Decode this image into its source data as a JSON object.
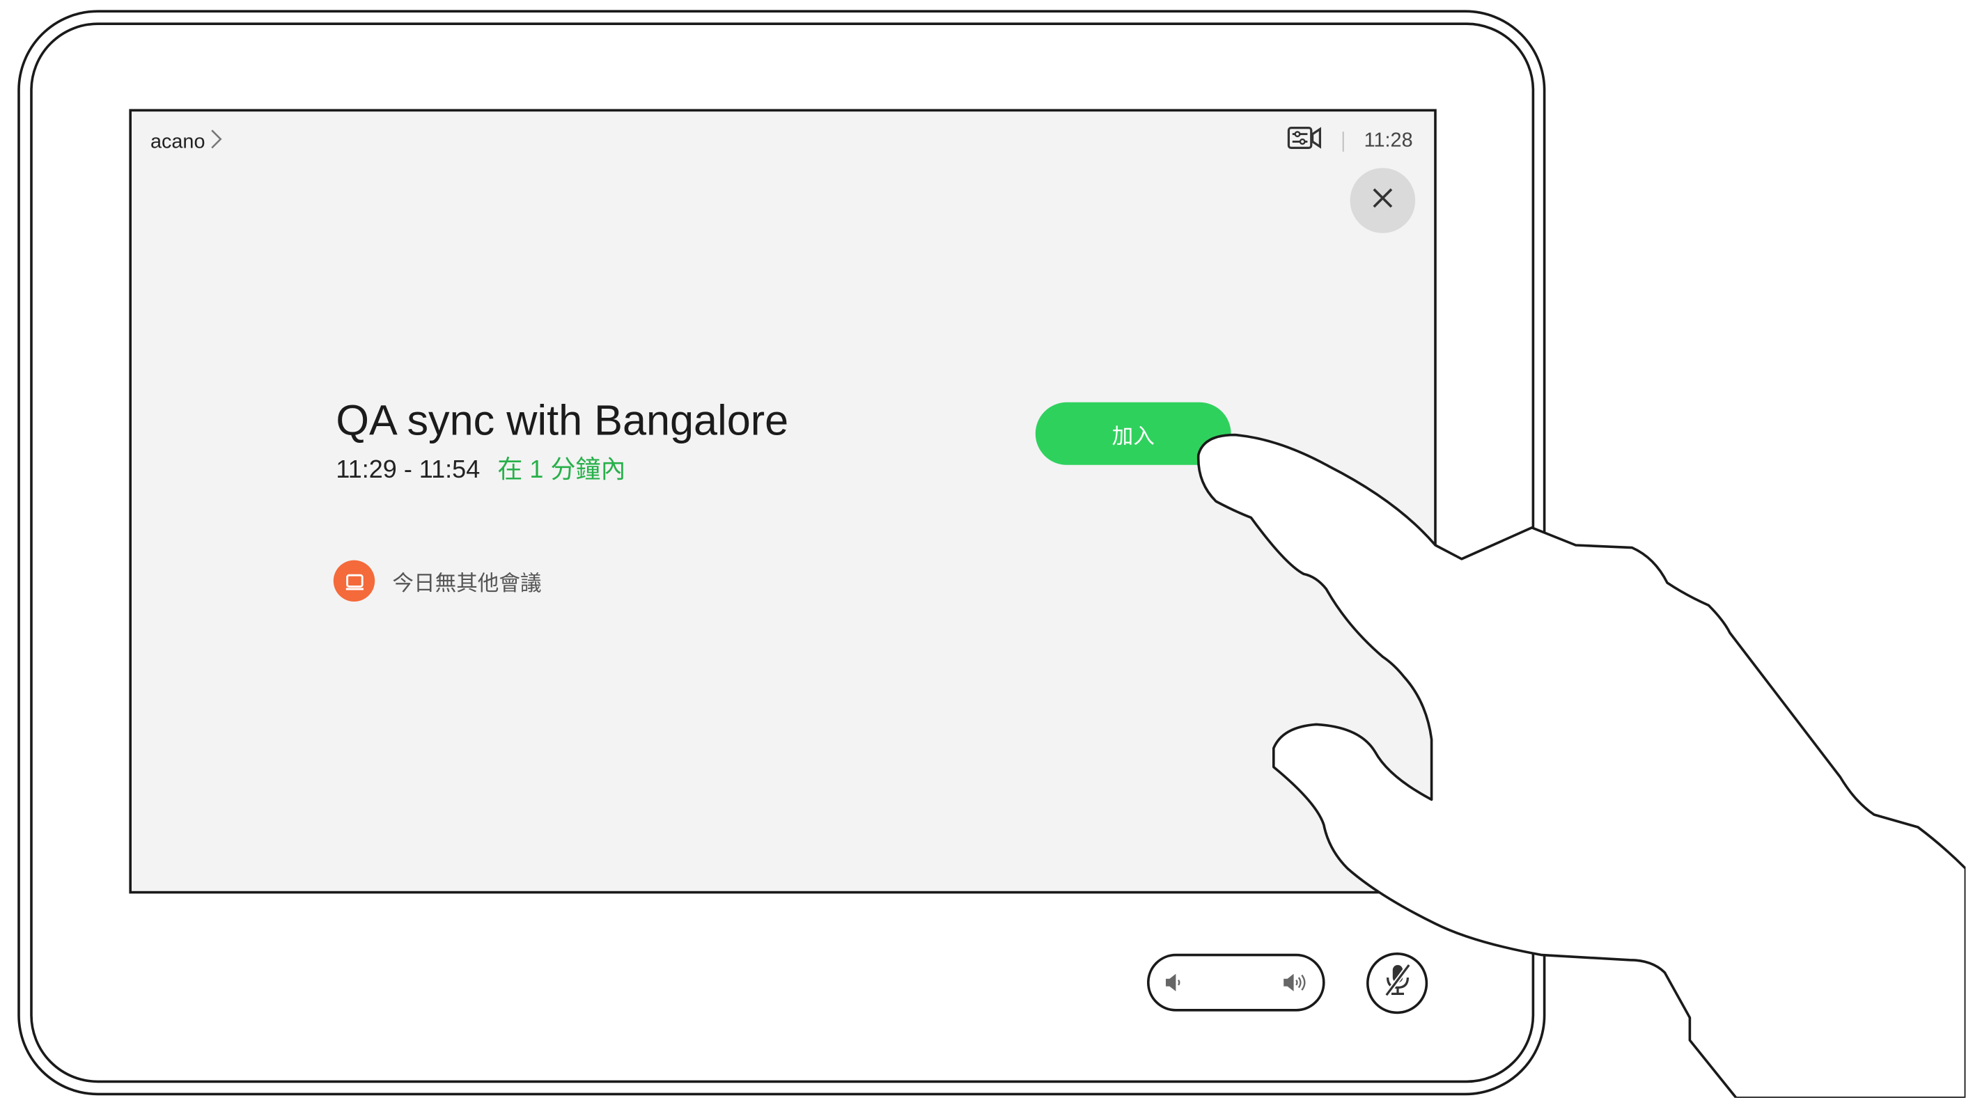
{
  "header": {
    "breadcrumb_label": "acano",
    "clock": "11:28"
  },
  "meeting": {
    "title": "QA sync with Bangalore",
    "time_range": "11:29 - 11:54",
    "starts_in": "在 1 分鐘內",
    "join_label": "加入"
  },
  "notice": {
    "text": "今日無其他會議"
  },
  "icons": {
    "breadcrumb_chevron": "chevron-right-icon",
    "camera_controls": "camera-settings-icon",
    "close": "close-icon",
    "calendar": "calendar-icon",
    "volume_down": "volume-down-icon",
    "volume_up": "volume-up-icon",
    "microphone_muted": "microphone-muted-icon"
  },
  "colors": {
    "join_green": "#2fd15d",
    "soon_green": "#27b04a",
    "notice_orange": "#f46a3a",
    "screen_bg": "#f3f3f3"
  }
}
